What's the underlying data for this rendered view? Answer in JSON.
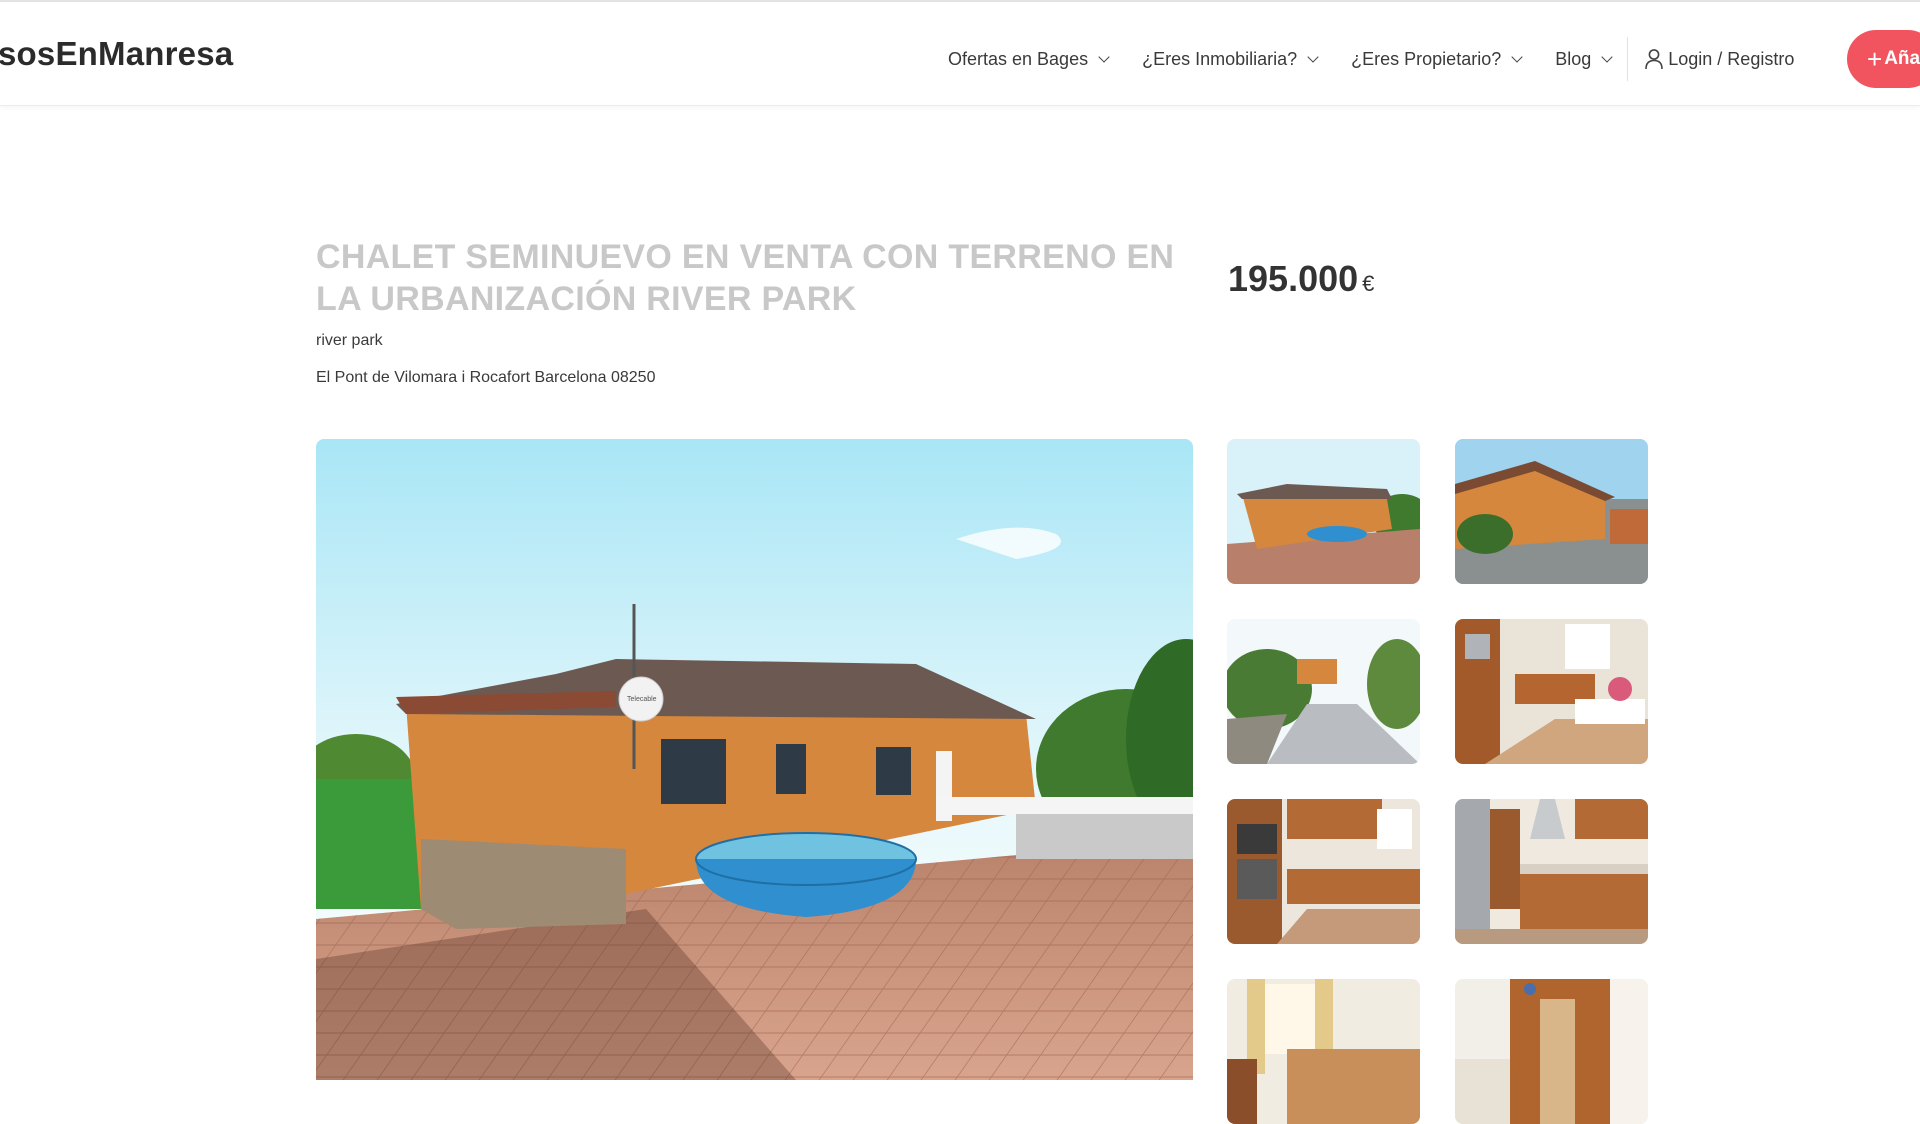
{
  "header": {
    "logo": "sosEnManresa",
    "nav": [
      {
        "label": "Ofertas en Bages"
      },
      {
        "label": "¿Eres Inmobiliaria?"
      },
      {
        "label": "¿Eres Propietario?"
      },
      {
        "label": "Blog"
      }
    ],
    "login_label": "Login / Registro",
    "add_label": "Aña",
    "add_plus": "+"
  },
  "listing": {
    "title": "CHALET SEMINUEVO EN VENTA CON TERRENO EN LA URBANIZACIÓN RIVER PARK",
    "subtitle": "river park",
    "address": "El Pont de Vilomara i Rocafort Barcelona 08250",
    "price": "195.000",
    "currency": "€"
  },
  "gallery": {
    "main": {
      "subject": "exterior-house-with-pool",
      "dish_label": "Telecable"
    },
    "thumbs": [
      {
        "subject": "exterior-pool-terrace"
      },
      {
        "subject": "exterior-house-paved-yard"
      },
      {
        "subject": "garden-driveway"
      },
      {
        "subject": "kitchen-dining"
      },
      {
        "subject": "kitchen-oven"
      },
      {
        "subject": "kitchen-counter"
      },
      {
        "subject": "bedroom"
      },
      {
        "subject": "wardrobe"
      }
    ]
  },
  "colors": {
    "accent": "#f1545e",
    "title": "#c8c8c8",
    "text": "#3a3a3a"
  }
}
